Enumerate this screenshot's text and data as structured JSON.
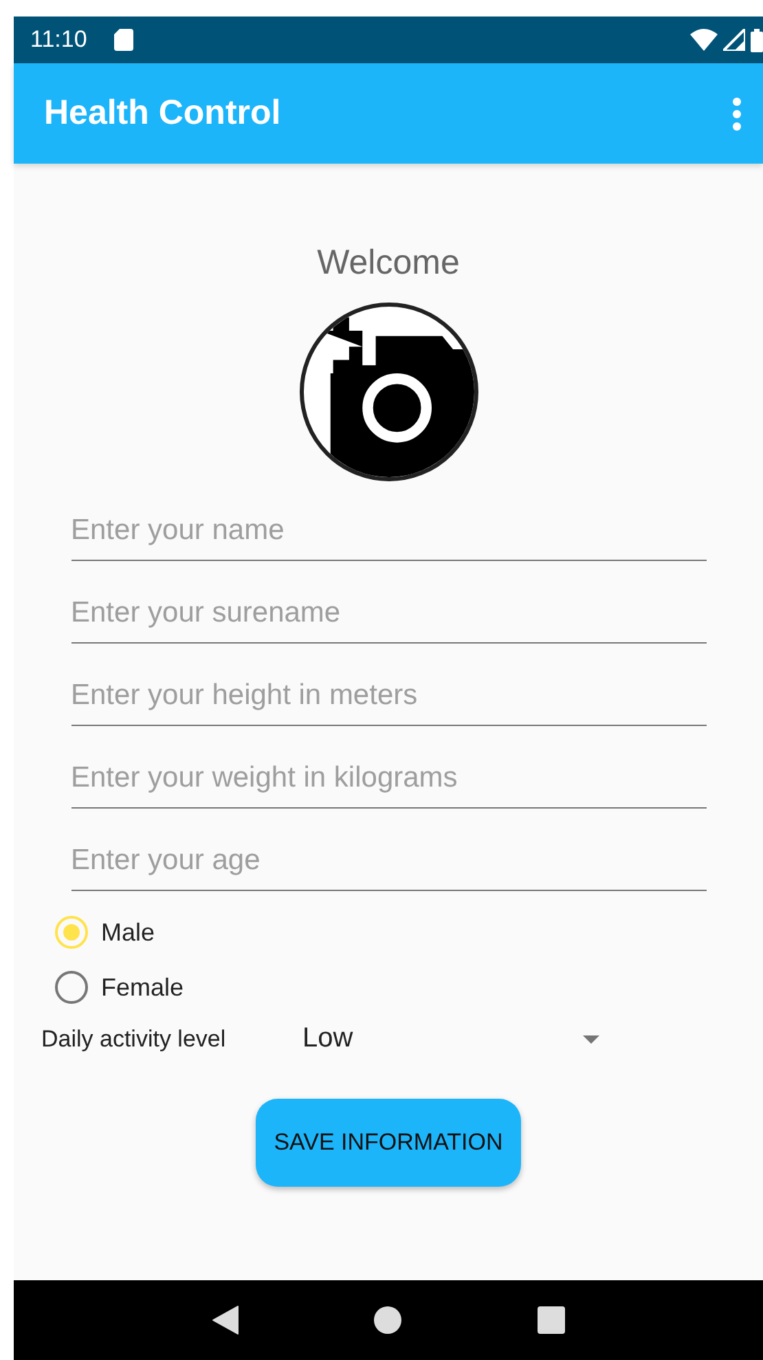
{
  "status_bar": {
    "time": "11:10"
  },
  "app_bar": {
    "title": "Health Control"
  },
  "welcome": "Welcome",
  "fields": [
    {
      "placeholder": "Enter your name"
    },
    {
      "placeholder": "Enter your surename"
    },
    {
      "placeholder": "Enter your height in meters"
    },
    {
      "placeholder": "Enter your weight in kilograms"
    },
    {
      "placeholder": "Enter your age"
    }
  ],
  "gender": [
    {
      "label": "Male",
      "selected": true
    },
    {
      "label": "Female",
      "selected": false
    }
  ],
  "activity": {
    "label": "Daily activity level",
    "value": "Low"
  },
  "save_button": "SAVE INFORMATION"
}
